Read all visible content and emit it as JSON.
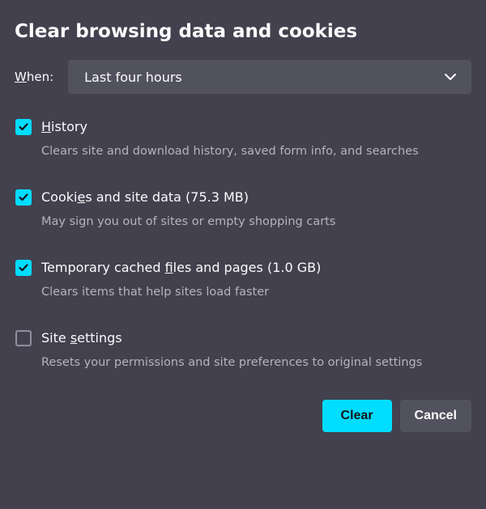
{
  "title": "Clear browsing data and cookies",
  "when": {
    "label_prefix_u": "W",
    "label_rest": "hen:",
    "selected": "Last four hours"
  },
  "options": [
    {
      "checked": true,
      "label_pre": "",
      "label_u": "H",
      "label_post": "istory",
      "size": "",
      "desc": "Clears site and download history, saved form info, and searches",
      "name": "option-history"
    },
    {
      "checked": true,
      "label_pre": "Cooki",
      "label_u": "e",
      "label_post": "s and site data",
      "size": " (75.3 MB)",
      "desc": "May sign you out of sites or empty shopping carts",
      "name": "option-cookies"
    },
    {
      "checked": true,
      "label_pre": "Temporary cached ",
      "label_u": "f",
      "label_post": "iles and pages",
      "size": " (1.0 GB)",
      "desc": "Clears items that help sites load faster",
      "name": "option-cache"
    },
    {
      "checked": false,
      "label_pre": "Site ",
      "label_u": "s",
      "label_post": "ettings",
      "size": "",
      "desc": "Resets your permissions and site preferences to original settings",
      "name": "option-site-settings"
    }
  ],
  "buttons": {
    "primary": "Clear",
    "secondary": "Cancel"
  }
}
